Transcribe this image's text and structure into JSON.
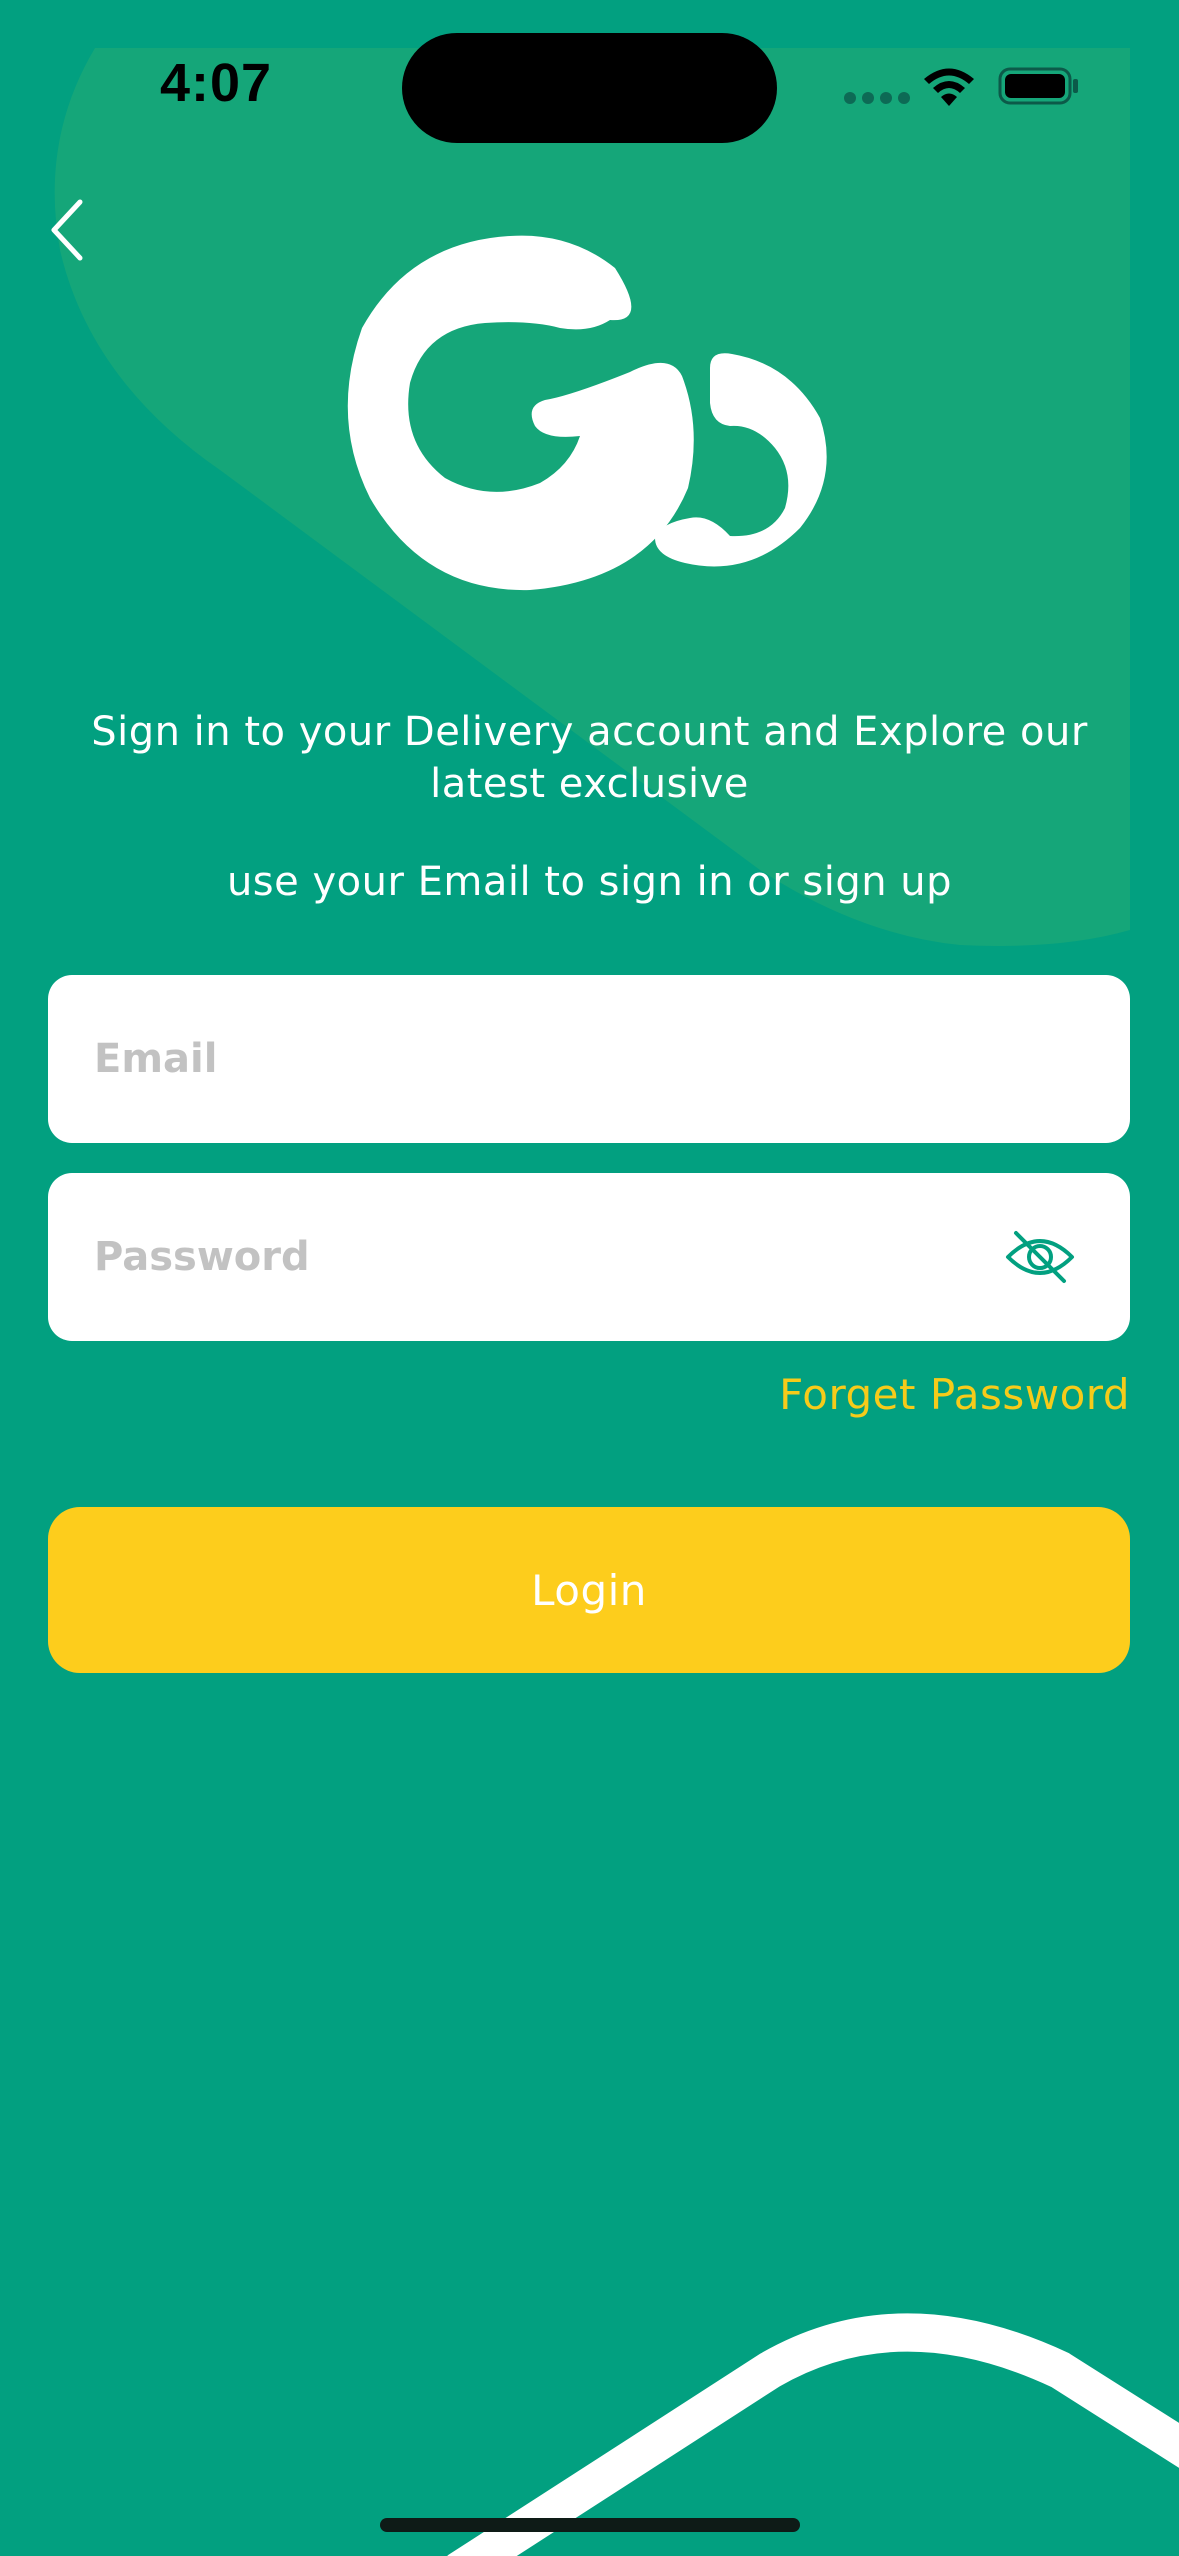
{
  "status_bar": {
    "time": "4:07"
  },
  "colors": {
    "background": "#02a080",
    "accent": "#fdcd1c",
    "link": "#f6cb1a",
    "input_bg": "#ffffff",
    "placeholder": "#c2c2c2"
  },
  "nav": {
    "back_icon": "chevron-left-icon"
  },
  "logo": {
    "icon": "go-logo"
  },
  "intro": {
    "subtitle": "Sign in to your Delivery account and Explore our latest exclusive",
    "helper": "use your Email to sign in or sign up"
  },
  "form": {
    "email": {
      "value": "",
      "placeholder": "Email"
    },
    "password": {
      "value": "",
      "placeholder": "Password",
      "toggle_icon": "eye-off-icon"
    },
    "forgot_label": "Forget Password",
    "login_label": "Login"
  }
}
